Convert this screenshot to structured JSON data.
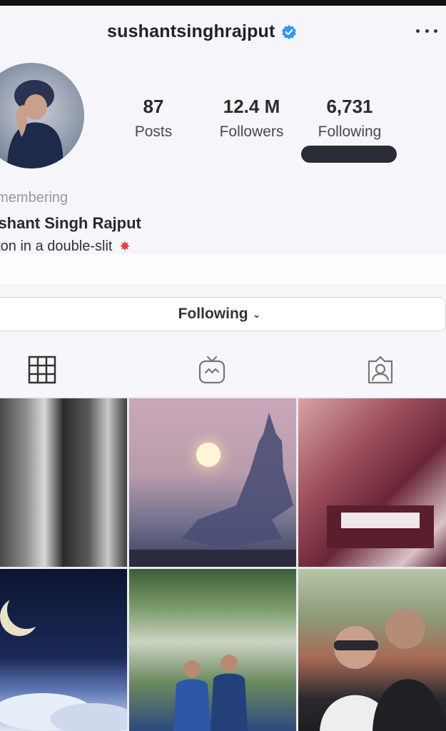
{
  "profile": {
    "username": "sushantsinghrajput",
    "verified": true,
    "menu_icon": "more-horizontal-icon"
  },
  "stats": {
    "posts": {
      "value": "87",
      "label": "Posts"
    },
    "followers": {
      "value": "12.4 M",
      "label": "Followers"
    },
    "following": {
      "value": "6,731",
      "label": "Following"
    }
  },
  "bio": {
    "category": "emembering",
    "name": "ushant Singh Rajput",
    "text": "oton in a double-slit"
  },
  "actions": {
    "follow_state": "Following",
    "follow_chevron": "⌄"
  },
  "tabs": [
    {
      "icon": "grid-icon",
      "active": true
    },
    {
      "icon": "igtv-icon",
      "active": false
    },
    {
      "icon": "tagged-person-icon",
      "active": false
    }
  ],
  "posts_grid": [
    {
      "icon": "photo-thumbnail"
    },
    {
      "icon": "photo-thumbnail"
    },
    {
      "icon": "photo-thumbnail"
    },
    {
      "icon": "photo-thumbnail"
    },
    {
      "icon": "photo-thumbnail"
    },
    {
      "icon": "photo-thumbnail"
    }
  ],
  "colors": {
    "verified_blue": "#3897f0",
    "text_primary": "#262626",
    "text_secondary": "#9a9a9a",
    "background": "#f5f5fa"
  }
}
